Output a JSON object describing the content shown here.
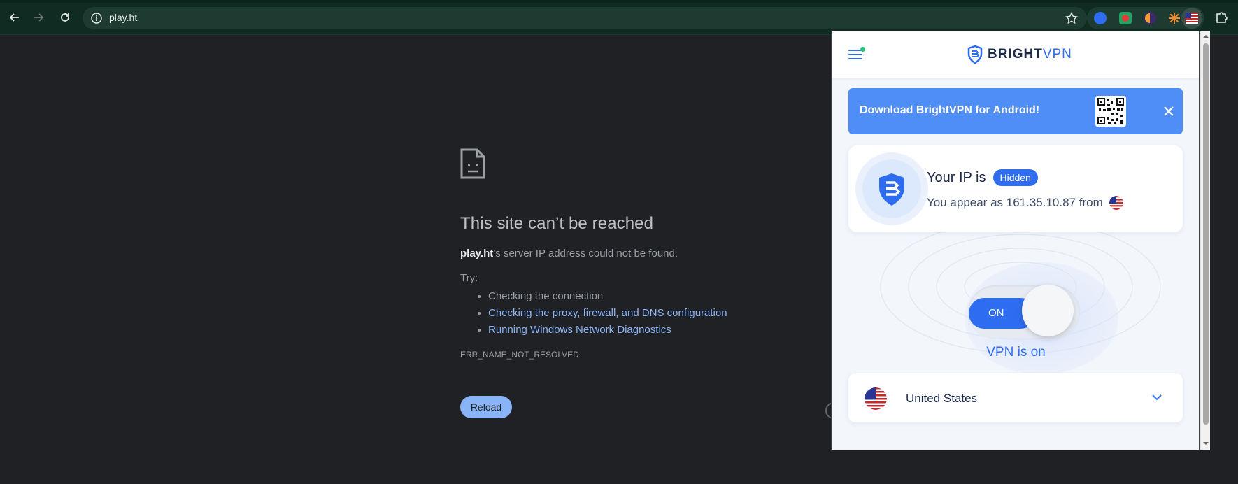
{
  "browser": {
    "url": "play.ht",
    "extensions": [
      "extension-1",
      "extension-2",
      "extension-3",
      "extension-4",
      "bright-vpn-flag-extension"
    ]
  },
  "error_page": {
    "title": "This site can’t be reached",
    "host": "play.ht",
    "description_rest": "’s server IP address could not be found.",
    "try_label": "Try:",
    "suggestions": [
      {
        "text": "Checking the connection",
        "link": false
      },
      {
        "text": "Checking the proxy, firewall, and DNS configuration",
        "link": true
      },
      {
        "text": "Running Windows Network Diagnostics",
        "link": true
      }
    ],
    "error_code": "ERR_NAME_NOT_RESOLVED",
    "reload_label": "Reload"
  },
  "vpn": {
    "brand_bold": "BRIGHT",
    "brand_light": "VPN",
    "banner_text": "Download BrightVPN for Android!",
    "ip_label": "Your IP is",
    "ip_status": "Hidden",
    "appear_text": "You appear as 161.35.10.87 from",
    "toggle_label": "ON",
    "status_text": "VPN is on",
    "country": "United States"
  },
  "colors": {
    "accent": "#2f6df0",
    "banner": "#4f8ef7",
    "link": "#8ab4f8"
  }
}
